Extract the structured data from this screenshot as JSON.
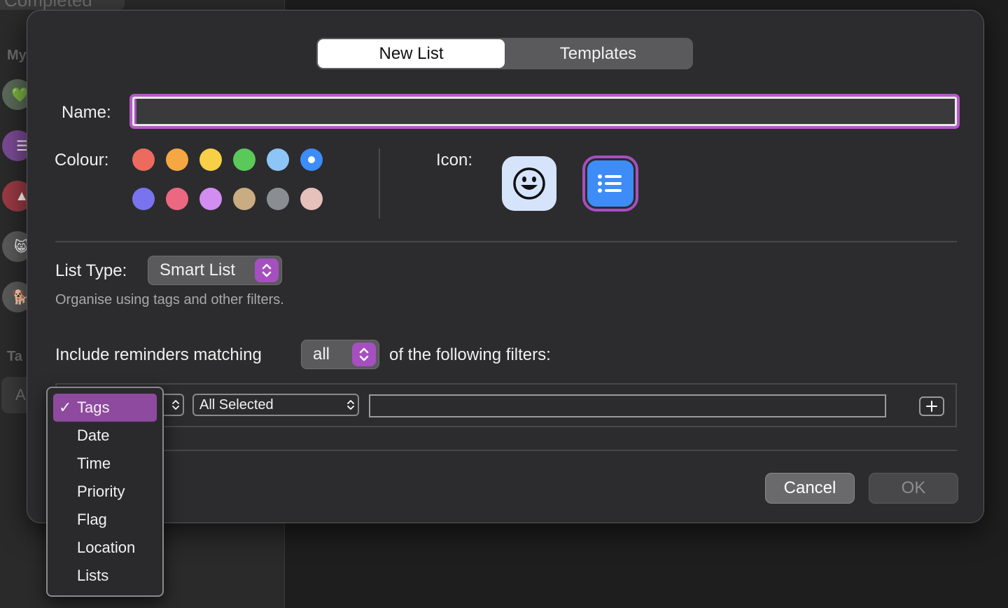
{
  "background": {
    "completed_label": "Completed",
    "my_lists_heading": "My",
    "tags_heading": "Ta",
    "tag_pill_label": "A",
    "list_icons": [
      {
        "name": "heart-icon",
        "glyph": "💚",
        "color": "#6a7a6a"
      },
      {
        "name": "list-icon",
        "glyph": "☰",
        "color": "#7a4a94"
      },
      {
        "name": "triangle-icon",
        "glyph": "▲",
        "color": "#9a3a44"
      },
      {
        "name": "cat-face-icon",
        "glyph": "😸",
        "color": "#6a6a6a"
      },
      {
        "name": "dog-icon",
        "glyph": "🐕",
        "color": "#6a6a6a"
      }
    ]
  },
  "tabs": {
    "new_list": "New List",
    "templates": "Templates"
  },
  "form": {
    "name_label": "Name:",
    "name_value": "",
    "colour_label": "Colour:",
    "icon_label": "Icon:",
    "colours": [
      {
        "name": "red",
        "hex": "#ec6a5e",
        "selected": false
      },
      {
        "name": "orange",
        "hex": "#f5a742",
        "selected": false
      },
      {
        "name": "yellow",
        "hex": "#f7d048",
        "selected": false
      },
      {
        "name": "green",
        "hex": "#5bc85a",
        "selected": false
      },
      {
        "name": "light-blue",
        "hex": "#8ec5f7",
        "selected": false
      },
      {
        "name": "blue",
        "hex": "#3d8cf7",
        "selected": true
      },
      {
        "name": "indigo",
        "hex": "#7a73f0",
        "selected": false
      },
      {
        "name": "pink",
        "hex": "#ec6880",
        "selected": false
      },
      {
        "name": "purple",
        "hex": "#d18ef0",
        "selected": false
      },
      {
        "name": "tan",
        "hex": "#c9ac82",
        "selected": false
      },
      {
        "name": "grey",
        "hex": "#8a8e93",
        "selected": false
      },
      {
        "name": "rose",
        "hex": "#e6c1bb",
        "selected": false
      }
    ],
    "icons": [
      {
        "name": "emoji-icon",
        "selected": false
      },
      {
        "name": "list-bullets-icon",
        "selected": true
      }
    ],
    "list_type_label": "List Type:",
    "list_type_value": "Smart List",
    "list_type_helper": "Organise using tags and other filters.",
    "include_prefix": "Include reminders matching",
    "match_value": "all",
    "include_suffix": "of the following filters:"
  },
  "filter_row": {
    "selector_value": "All Selected",
    "text_value": ""
  },
  "filter_menu": {
    "items": [
      "Tags",
      "Date",
      "Time",
      "Priority",
      "Flag",
      "Location",
      "Lists"
    ],
    "selected": "Tags",
    "check_glyph": "✓"
  },
  "buttons": {
    "cancel": "Cancel",
    "ok": "OK"
  },
  "accent_color": "#a64fc0"
}
